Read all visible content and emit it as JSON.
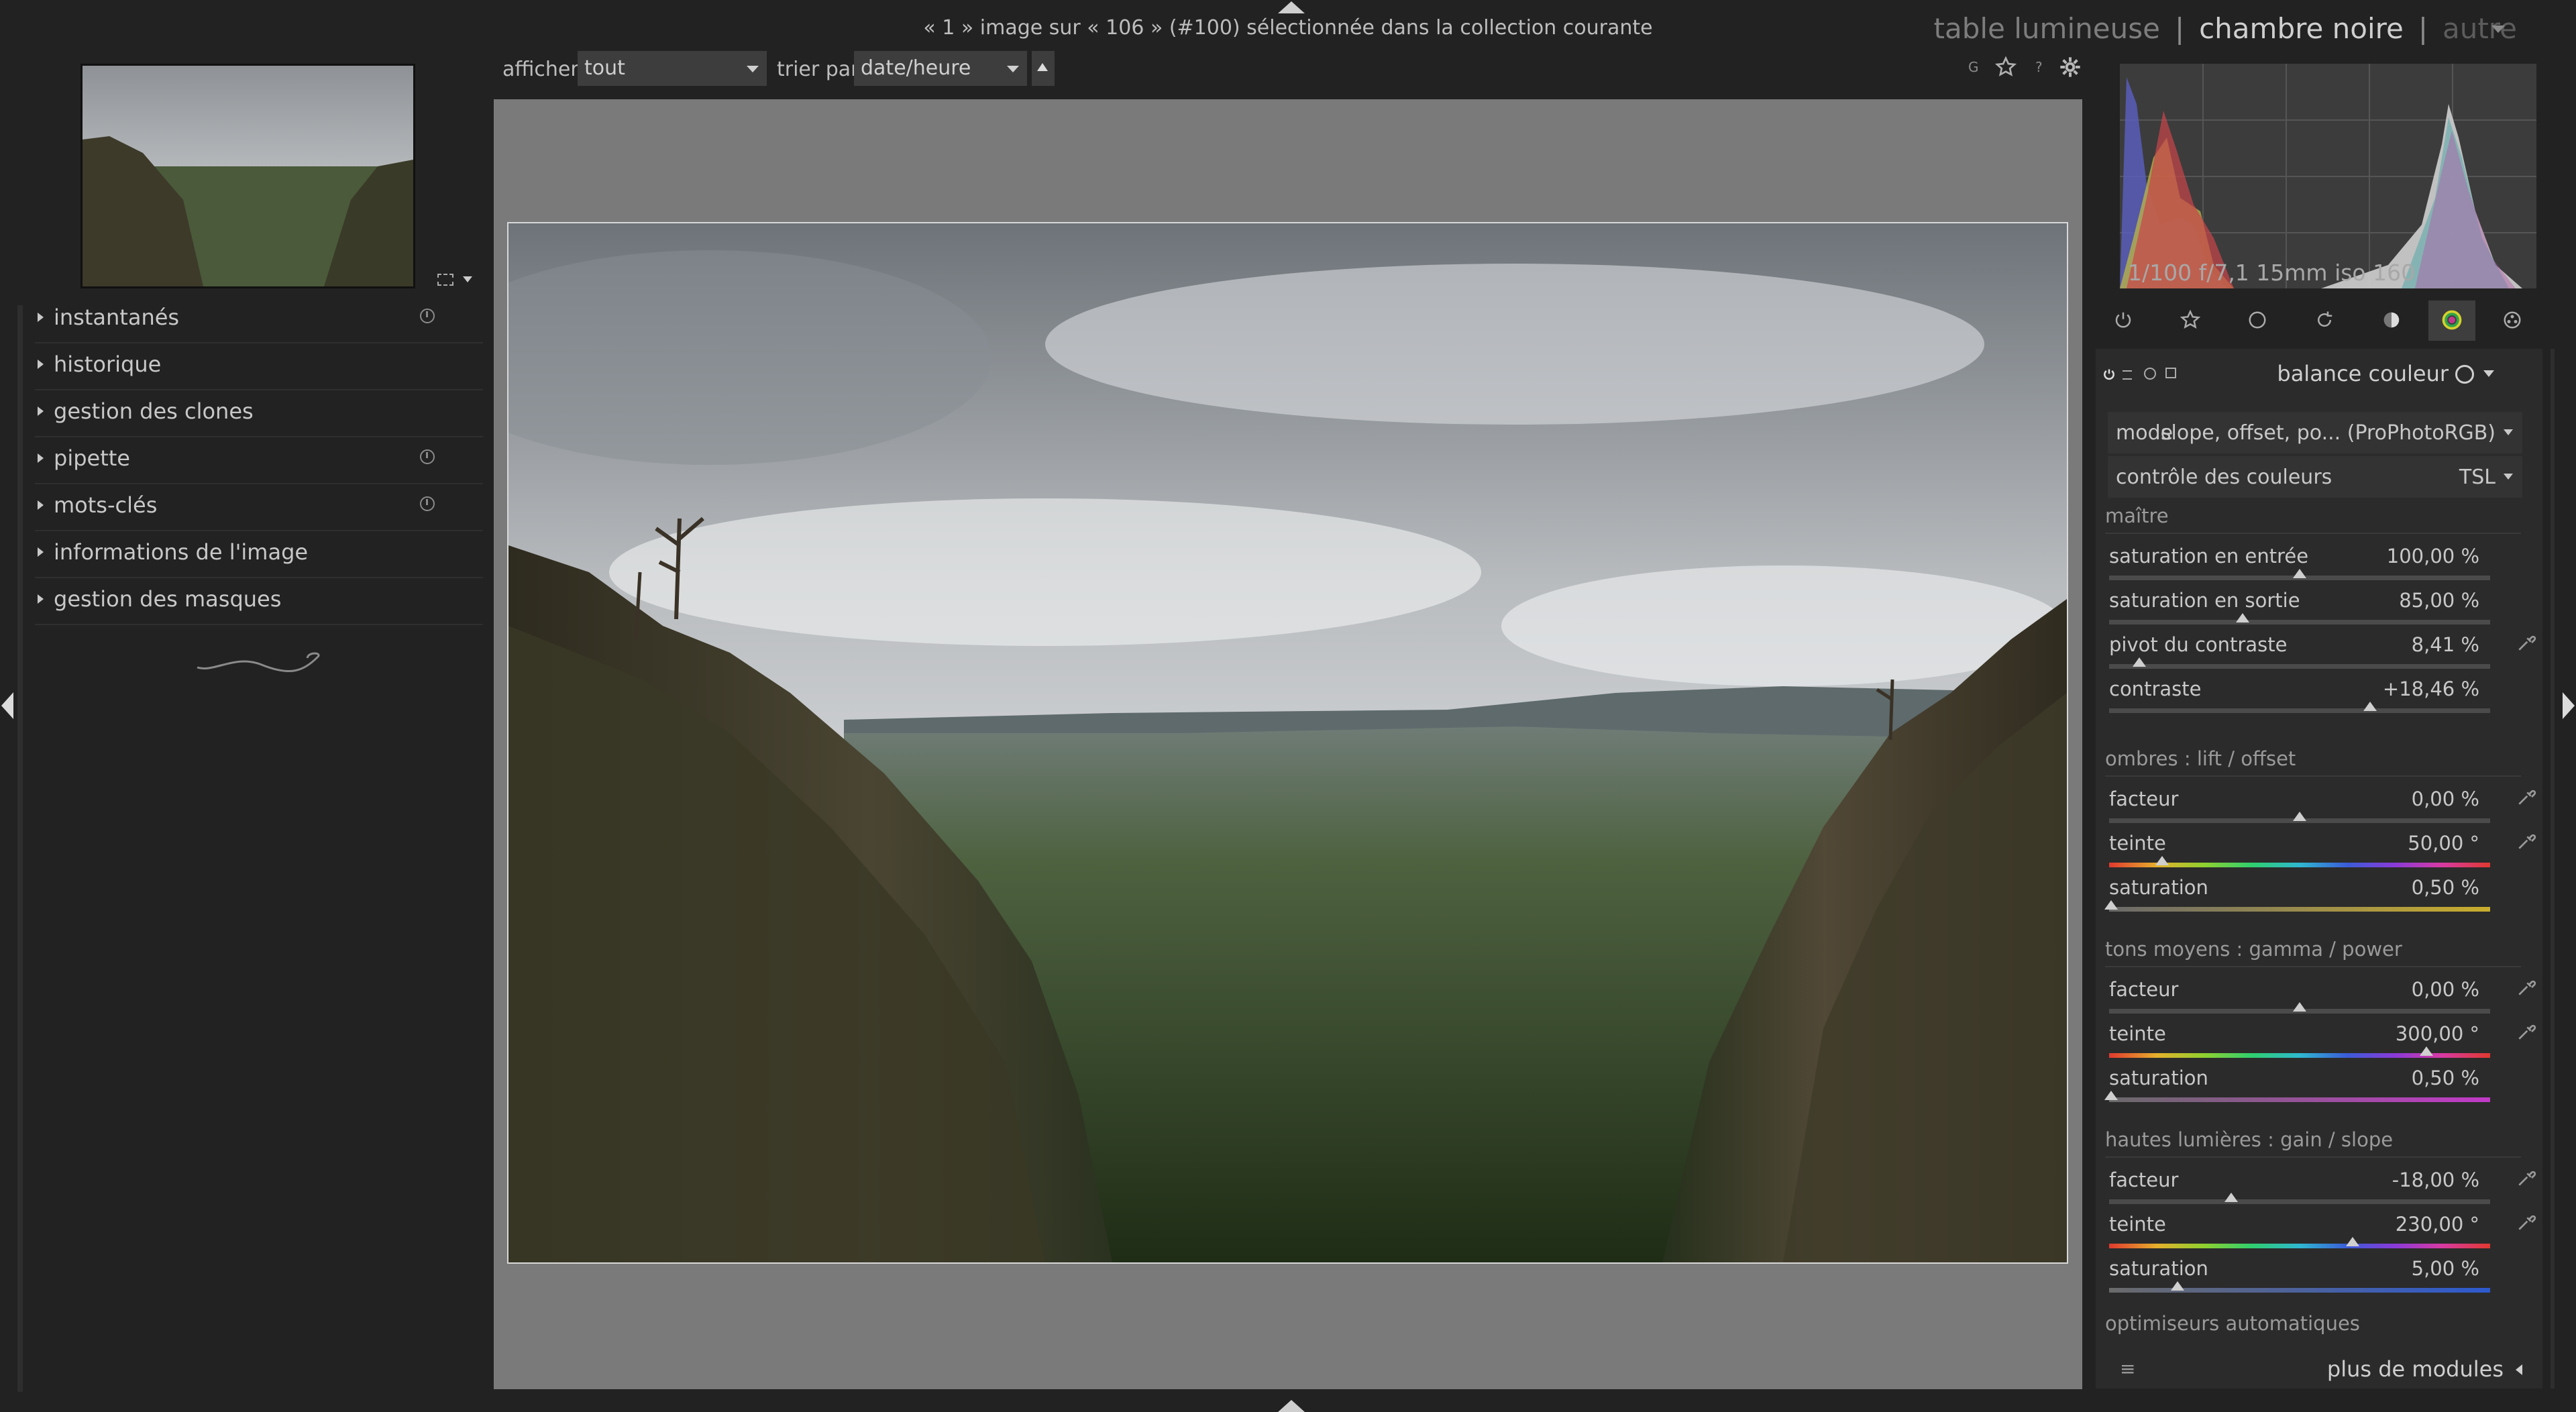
{
  "status": {
    "selection_text": "« 1 » image sur « 106 » (#100) sélectionnée dans la collection courante"
  },
  "views": {
    "lighttable": "table lumineuse",
    "darkroom": "chambre noire",
    "other": "autre",
    "separator": "|"
  },
  "filterbar": {
    "show_label": "afficher",
    "show_value": "tout",
    "sort_label": "trier par",
    "sort_value": "date/heure",
    "icons": [
      "grouping-icon",
      "star-icon",
      "help-icon",
      "gear-icon"
    ],
    "grouping_glyph": "G",
    "help_glyph": "?"
  },
  "left_modules": [
    {
      "label": "instantanés",
      "has_reset": true
    },
    {
      "label": "historique",
      "has_reset": false
    },
    {
      "label": "gestion des clones",
      "has_reset": false
    },
    {
      "label": "pipette",
      "has_reset": true
    },
    {
      "label": "mots-clés",
      "has_reset": true
    },
    {
      "label": "informations de l'image",
      "has_reset": false
    },
    {
      "label": "gestion des masques",
      "has_reset": false
    }
  ],
  "histogram": {
    "exif": "1/100 f/7,1 15mm iso 160"
  },
  "module_groups": [
    "power-icon",
    "favorites-icon",
    "circle-icon",
    "rotate-icon",
    "tone-icon",
    "color-icon",
    "effects-icon"
  ],
  "module": {
    "title": "balance couleur",
    "mode_label": "mode",
    "mode_value": "slope, offset, po... (ProPhotoRGB)",
    "color_control_label": "contrôle des couleurs",
    "color_control_value": "TSL",
    "sections": [
      {
        "title": "maître",
        "sliders": [
          {
            "name": "saturation en entrée",
            "value": "100,00 %",
            "position": 0.5,
            "picker": false,
            "track": "gray"
          },
          {
            "name": "saturation en sortie",
            "value": "85,00 %",
            "position": 0.35,
            "picker": false,
            "track": "gray"
          },
          {
            "name": "pivot du contraste",
            "value": "8,41 %",
            "position": 0.08,
            "picker": true,
            "track": "gray"
          },
          {
            "name": "contraste",
            "value": "+18,46 %",
            "position": 0.685,
            "picker": false,
            "track": "gray"
          }
        ]
      },
      {
        "title": "ombres : lift / offset",
        "sliders": [
          {
            "name": "facteur",
            "value": "0,00 %",
            "position": 0.5,
            "picker": true,
            "track": "gray"
          },
          {
            "name": "teinte",
            "value": "50,00 °",
            "position": 0.139,
            "picker": true,
            "track": "hue"
          },
          {
            "name": "saturation",
            "value": "0,50 %",
            "position": 0.005,
            "picker": false,
            "track": "sat-yellow"
          }
        ]
      },
      {
        "title": "tons moyens : gamma / power",
        "sliders": [
          {
            "name": "facteur",
            "value": "0,00 %",
            "position": 0.5,
            "picker": true,
            "track": "gray"
          },
          {
            "name": "teinte",
            "value": "300,00 °",
            "position": 0.833,
            "picker": true,
            "track": "hue"
          },
          {
            "name": "saturation",
            "value": "0,50 %",
            "position": 0.005,
            "picker": false,
            "track": "sat-magenta"
          }
        ]
      },
      {
        "title": "hautes lumières : gain / slope",
        "sliders": [
          {
            "name": "facteur",
            "value": "-18,00 %",
            "position": 0.32,
            "picker": true,
            "track": "gray"
          },
          {
            "name": "teinte",
            "value": "230,00 °",
            "position": 0.639,
            "picker": true,
            "track": "hue"
          },
          {
            "name": "saturation",
            "value": "5,00 %",
            "position": 0.18,
            "picker": false,
            "track": "sat-blue"
          }
        ]
      }
    ],
    "next_section": "optimiseurs automatiques"
  },
  "bottom": {
    "more_modules": "plus de modules",
    "menu_glyph": "≡"
  },
  "colors": {
    "background": "#222222",
    "panel": "#2b2b2b",
    "center": "#7a7a7a",
    "text": "#c8c8c8"
  }
}
